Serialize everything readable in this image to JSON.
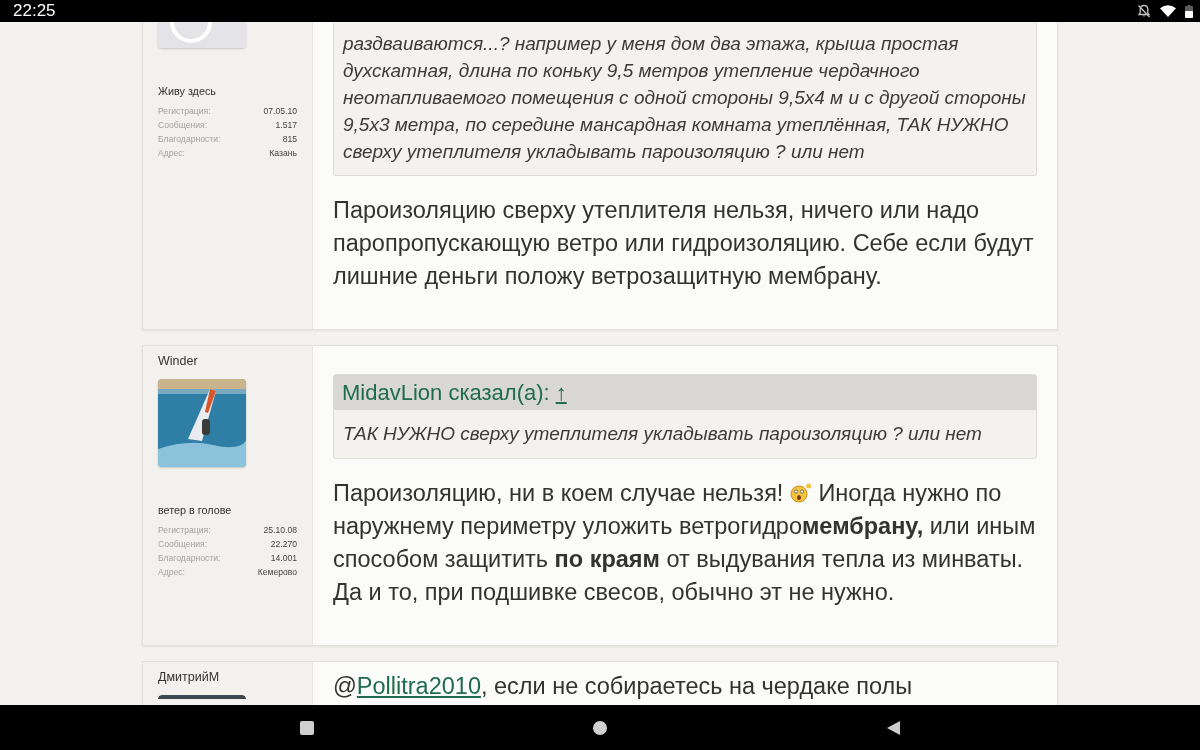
{
  "status_bar": {
    "time": "22:25"
  },
  "posts": [
    {
      "avatar": {
        "kind": "placeholder"
      },
      "user_title": "Живу здесь",
      "stats": [
        {
          "label": "Регистрация:",
          "value": "07.05.10"
        },
        {
          "label": "Сообщения:",
          "value": "1.517"
        },
        {
          "label": "Благодарности:",
          "value": "815"
        },
        {
          "label": "Адрес:",
          "value": "Казань"
        }
      ],
      "quote": {
        "text": "раздваиваются...? например у меня дом два этажа, крыша простая духскатная, длина по коньку 9,5 метров утепление чердачного неотапливаемого помещения с одной стороны 9,5x4 м и с другой стороны 9,5x3 метра, по середине мансардная комната утеплённая, ТАК НУЖНО сверху утеплителя укладывать пароизоляцию ? или нет"
      },
      "body": [
        {
          "kind": "text",
          "text": "Пароизоляцию сверху утеплителя нельзя, ничего или надо паропропускающую ветро или гидроизоляцию. Себе если будут лишние деньги положу ветрозащитную мембрану."
        }
      ]
    },
    {
      "username": "Winder",
      "avatar": {
        "kind": "photo"
      },
      "user_title": "ветер в голове",
      "stats": [
        {
          "label": "Регистрация:",
          "value": "25.10.08"
        },
        {
          "label": "Сообщения:",
          "value": "22.270"
        },
        {
          "label": "Благодарности:",
          "value": "14.001"
        },
        {
          "label": "Адрес:",
          "value": "Кемерово"
        }
      ],
      "quote": {
        "author": "MidavLion сказал(а):",
        "link": "↑",
        "text": "ТАК НУЖНО сверху утеплителя укладывать пароизоляцию ? или нет"
      },
      "body": [
        {
          "kind": "text",
          "text": "Пароизоляцию, ни в коем случае нельзя!"
        },
        {
          "kind": "emoji"
        },
        {
          "kind": "text",
          "text": "Иногда нужно по наружнему периметру уложить ветрогидро**мембрану,** или иным способом защитить **по краям** от выдувания тепла из минваты. Да и то, при подшивке свесов, обычно эт не нужно."
        }
      ]
    },
    {
      "username": "ДмитрийМ",
      "avatar": {
        "kind": "photo"
      },
      "body": [
        {
          "kind": "text",
          "text": "@"
        },
        {
          "kind": "mention",
          "text": "Pollitra2010"
        },
        {
          "kind": "text",
          "text": ", если не собираетесь на чердаке полы"
        }
      ]
    }
  ]
}
